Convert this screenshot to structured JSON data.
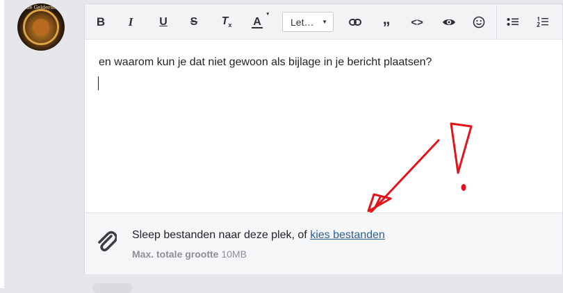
{
  "toolbar": {
    "bold": "B",
    "italic": "I",
    "underline": "U",
    "strike": "S",
    "clear_format": "T",
    "clear_format_sub": "x",
    "text_color": "A",
    "font_select_value": "Let…",
    "quote": "”",
    "code": "<>"
  },
  "editor": {
    "text": "en waarom kun je dat niet gewoon als bijlage in je bericht plaatsen?"
  },
  "attachments": {
    "prompt": "Sleep bestanden naar deze plek, of ",
    "link": "kies bestanden",
    "max_label": "Max. totale grootte",
    "max_value": "10MB"
  },
  "avatar": {
    "text": "de Gelderse"
  },
  "annotation_color": "#e3121b"
}
